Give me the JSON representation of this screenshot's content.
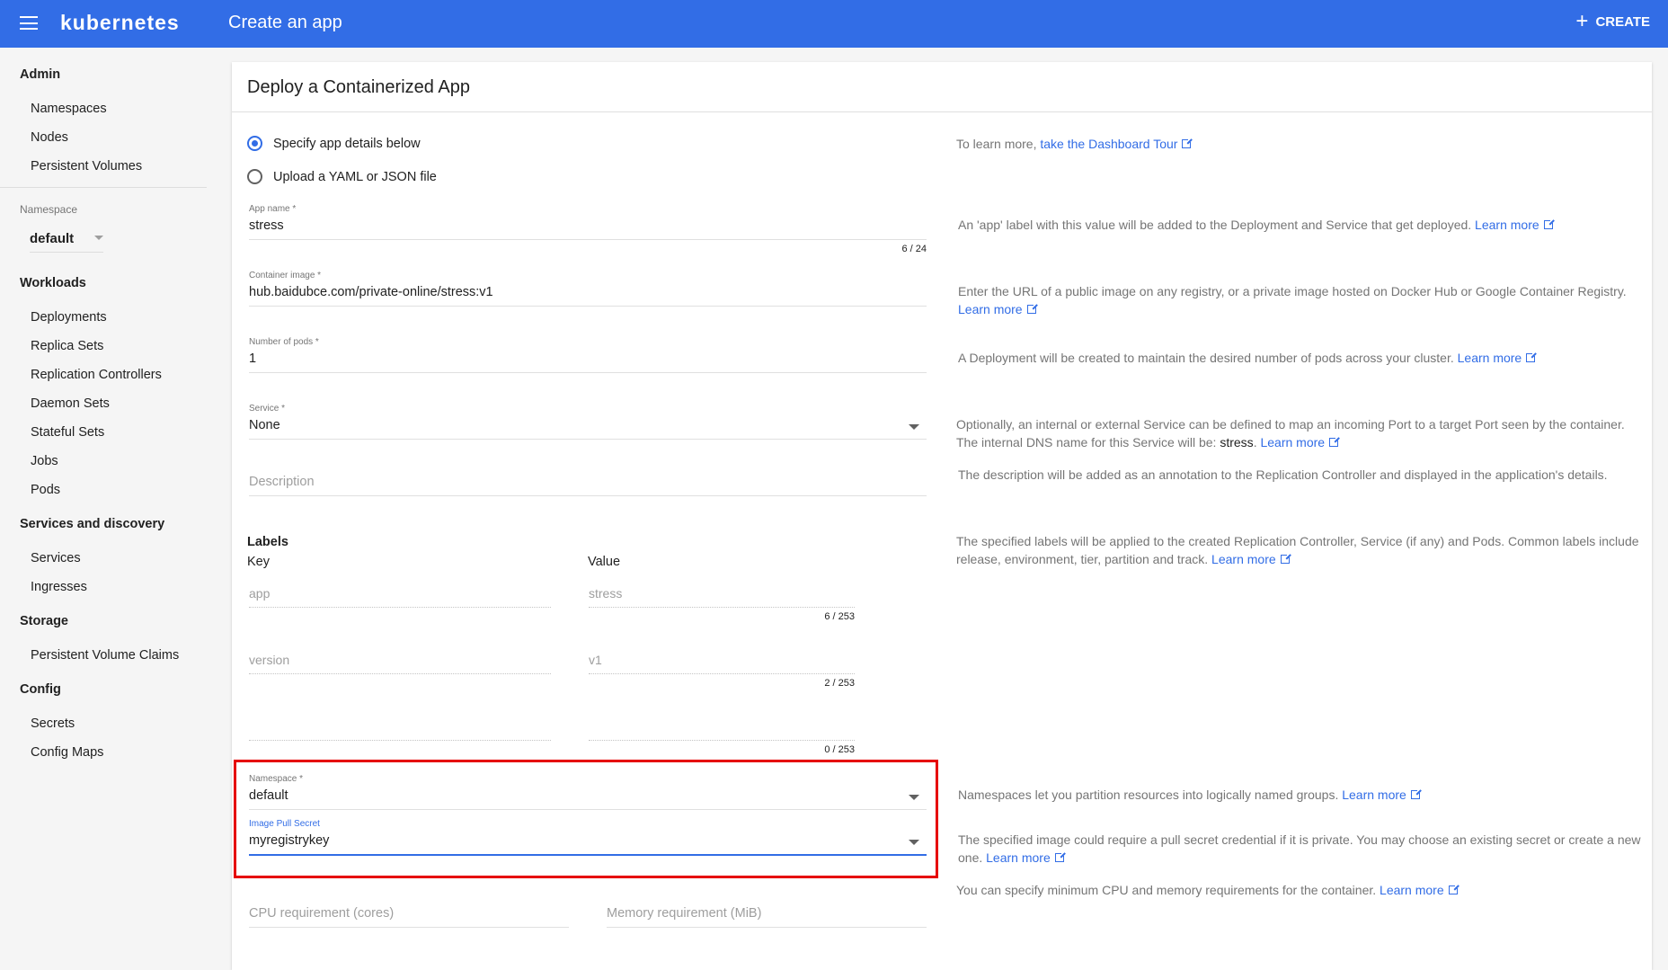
{
  "topbar": {
    "brand": "kubernetes",
    "title": "Create an app",
    "create_label": "CREATE"
  },
  "sidebar": {
    "admin": "Admin",
    "admin_items": [
      "Namespaces",
      "Nodes",
      "Persistent Volumes"
    ],
    "namespace_label": "Namespace",
    "namespace_value": "default",
    "workloads": "Workloads",
    "workload_items": [
      "Deployments",
      "Replica Sets",
      "Replication Controllers",
      "Daemon Sets",
      "Stateful Sets",
      "Jobs",
      "Pods"
    ],
    "services": "Services and discovery",
    "service_items": [
      "Services",
      "Ingresses"
    ],
    "storage": "Storage",
    "storage_items": [
      "Persistent Volume Claims"
    ],
    "config": "Config",
    "config_items": [
      "Secrets",
      "Config Maps"
    ]
  },
  "card": {
    "title": "Deploy a Containerized App",
    "radio_specify": "Specify app details below",
    "radio_upload": "Upload a YAML or JSON file",
    "app_name_label": "App name *",
    "app_name_value": "stress",
    "app_name_counter": "6 / 24",
    "container_image_label": "Container image *",
    "container_image_value": "hub.baidubce.com/private-online/stress:v1",
    "pods_label": "Number of pods *",
    "pods_value": "1",
    "service_label": "Service *",
    "service_value": "None",
    "description_placeholder": "Description",
    "labels_title": "Labels",
    "key_head": "Key",
    "value_head": "Value",
    "labels": [
      {
        "key": "app",
        "value": "stress",
        "counter": "6 / 253"
      },
      {
        "key": "version",
        "value": "v1",
        "counter": "2 / 253"
      },
      {
        "key": "",
        "value": "",
        "counter": "0 / 253"
      }
    ],
    "namespace_label": "Namespace *",
    "namespace_value": "default",
    "pull_secret_label": "Image Pull Secret",
    "pull_secret_value": "myregistrykey",
    "cpu_placeholder": "CPU requirement (cores)",
    "memory_placeholder": "Memory requirement (MiB)"
  },
  "help": {
    "tour_prefix": "To learn more, ",
    "tour_link": "take the Dashboard Tour",
    "app_name": "An 'app' label with this value will be added to the Deployment and Service that get deployed.",
    "container_image": "Enter the URL of a public image on any registry, or a private image hosted on Docker Hub or Google Container Registry.",
    "pods": "A Deployment will be created to maintain the desired number of pods across your cluster.",
    "service_line1": "Optionally, an internal or external Service can be defined to map an incoming Port to a target Port seen by the container.",
    "service_line2_prefix": "The internal DNS name for this Service will be: ",
    "service_dns": "stress",
    "service_line2_suffix": ".",
    "description": "The description will be added as an annotation to the Replication Controller and displayed in the application's details.",
    "labels": "The specified labels will be applied to the created Replication Controller, Service (if any) and Pods. Common labels include release, environment, tier, partition and track.",
    "namespace": "Namespaces let you partition resources into logically named groups.",
    "pull_secret": "The specified image could require a pull secret credential if it is private. You may choose an existing secret or create a new one.",
    "resources": "You can specify minimum CPU and memory requirements for the container.",
    "learn_more": "Learn more"
  },
  "colors": {
    "primary": "#326de6",
    "highlight": "#e60000"
  },
  "icons": [
    "menu-icon",
    "plus-icon",
    "external-link-icon",
    "dropdown-caret-icon"
  ]
}
